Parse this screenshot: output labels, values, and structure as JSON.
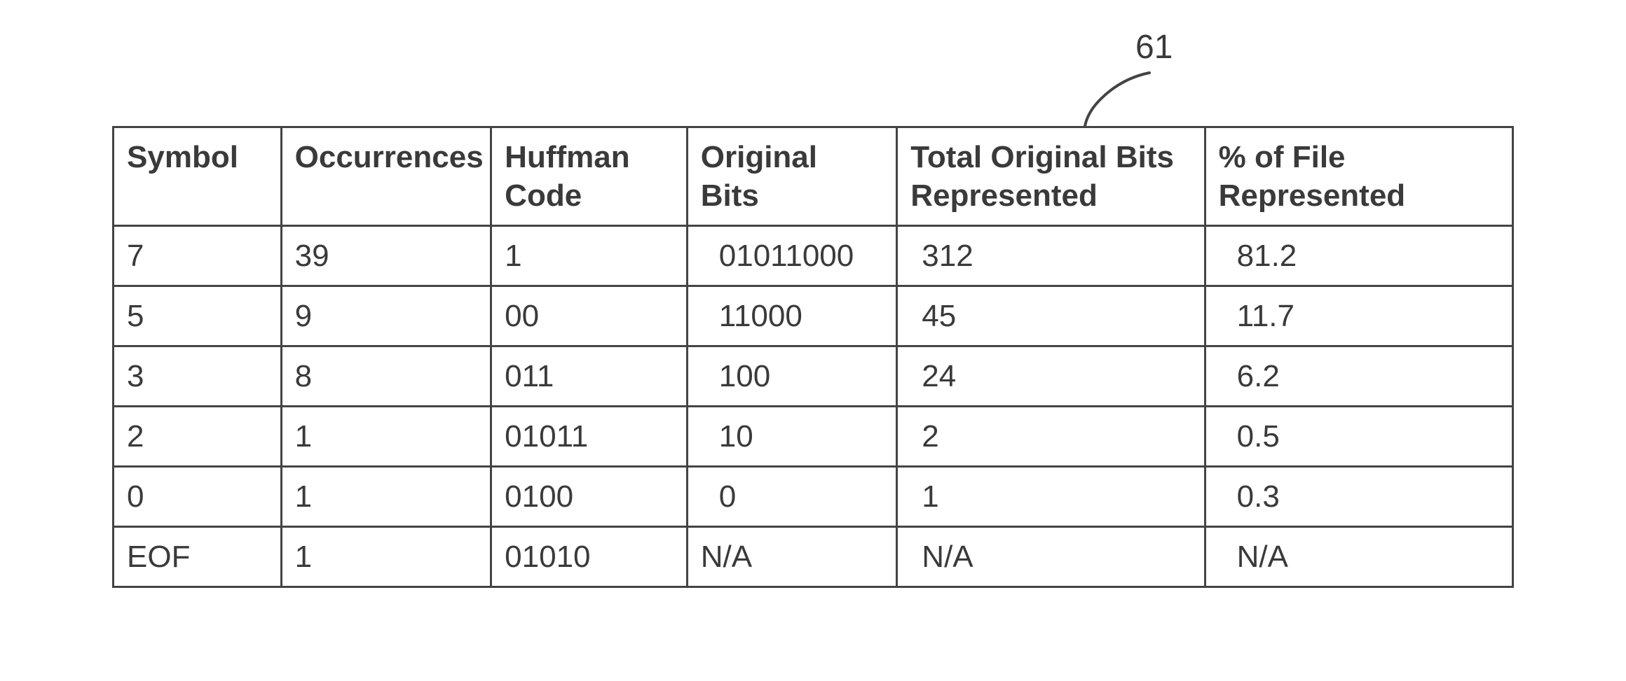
{
  "callout": "61",
  "headers": {
    "symbol": "Symbol",
    "occurrences": "Occurrences",
    "huffman": "Huffman Code",
    "original_bits": "Original Bits",
    "total_original_bits": "Total Original Bits Represented",
    "percent_file": "% of File Represented"
  },
  "rows": [
    {
      "symbol": "7",
      "occurrences": "39",
      "huffman": "1",
      "original_bits": "01011000",
      "total_original_bits": "312",
      "percent_file": "81.2"
    },
    {
      "symbol": "5",
      "occurrences": "9",
      "huffman": "00",
      "original_bits": "11000",
      "total_original_bits": "45",
      "percent_file": "11.7"
    },
    {
      "symbol": "3",
      "occurrences": "8",
      "huffman": "011",
      "original_bits": "100",
      "total_original_bits": "24",
      "percent_file": "6.2"
    },
    {
      "symbol": "2",
      "occurrences": "1",
      "huffman": "01011",
      "original_bits": "10",
      "total_original_bits": "2",
      "percent_file": "0.5"
    },
    {
      "symbol": "0",
      "occurrences": "1",
      "huffman": "0100",
      "original_bits": "0",
      "total_original_bits": "1",
      "percent_file": "0.3"
    },
    {
      "symbol": "EOF",
      "occurrences": "1",
      "huffman": "01010",
      "original_bits": "N/A",
      "total_original_bits": "N/A",
      "percent_file": "N/A"
    }
  ],
  "chart_data": {
    "type": "table",
    "title": "Huffman coding symbol table (figure reference 61)",
    "columns": [
      "Symbol",
      "Occurrences",
      "Huffman Code",
      "Original Bits",
      "Total Original Bits Represented",
      "% of File Represented"
    ],
    "rows": [
      [
        "7",
        "39",
        "1",
        "01011000",
        "312",
        "81.2"
      ],
      [
        "5",
        "9",
        "00",
        "11000",
        "45",
        "11.7"
      ],
      [
        "3",
        "8",
        "011",
        "100",
        "24",
        "6.2"
      ],
      [
        "2",
        "1",
        "01011",
        "10",
        "2",
        "0.5"
      ],
      [
        "0",
        "1",
        "0100",
        "0",
        "1",
        "0.3"
      ],
      [
        "EOF",
        "1",
        "01010",
        "N/A",
        "N/A",
        "N/A"
      ]
    ]
  }
}
